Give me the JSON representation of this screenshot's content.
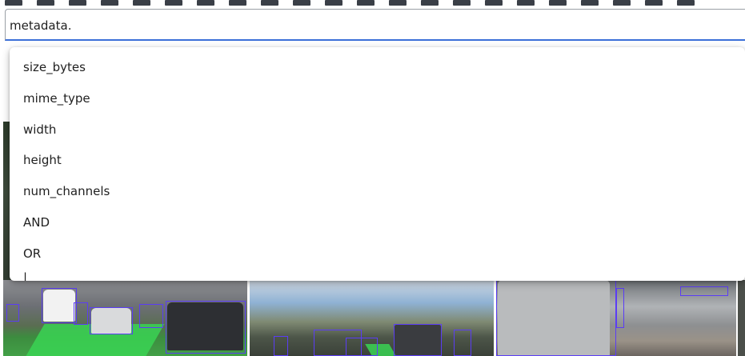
{
  "query": {
    "value": "metadata."
  },
  "autocomplete": {
    "items": [
      "size_bytes",
      "mime_type",
      "width",
      "height",
      "num_channels",
      "AND",
      "OR",
      "|"
    ]
  },
  "colors": {
    "focus_underline": "#3b6fd8",
    "bbox": "#5b3df5",
    "segmentation": "#39d353"
  }
}
